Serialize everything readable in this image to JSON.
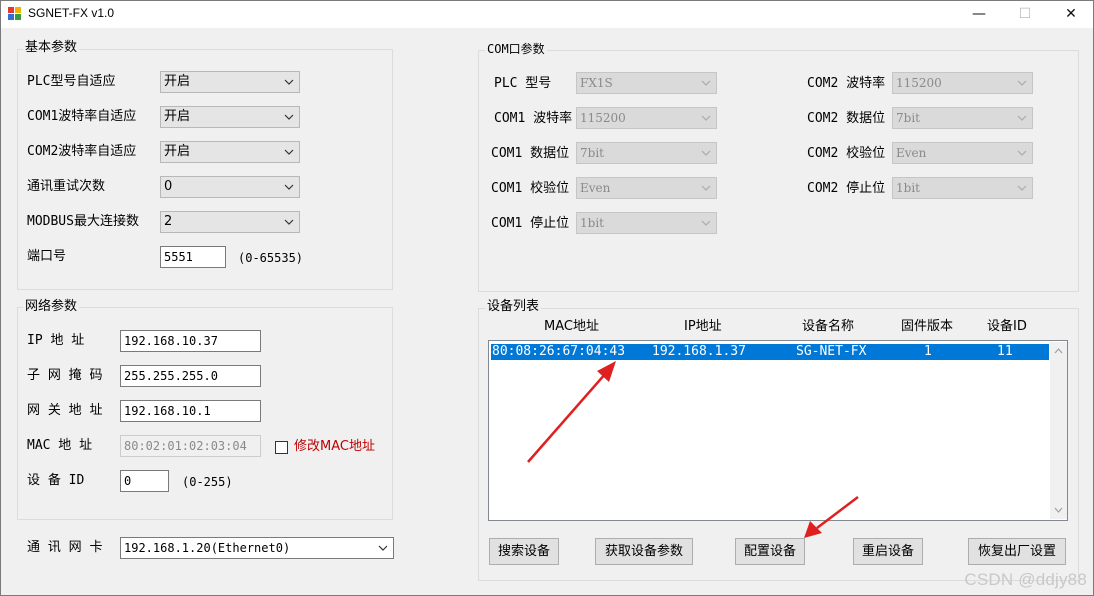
{
  "window": {
    "title": "SGNET-FX v1.0",
    "minimize": "—",
    "maximize": "☐",
    "close": "✕"
  },
  "basic": {
    "title": "基本参数",
    "rows": [
      {
        "label": "PLC型号自适应",
        "value": "开启"
      },
      {
        "label": "COM1波特率自适应",
        "value": "开启"
      },
      {
        "label": "COM2波特率自适应",
        "value": "开启"
      },
      {
        "label": "通讯重试次数",
        "value": "0"
      },
      {
        "label": "MODBUS最大连接数",
        "value": "2"
      }
    ],
    "port_label": "端口号",
    "port_value": "5551",
    "port_range": "(0-65535)"
  },
  "com": {
    "title": "COM口参数",
    "left": [
      {
        "label": "PLC 型号",
        "value": "FX1S"
      },
      {
        "label": "COM1 波特率",
        "value": "115200"
      },
      {
        "label": "COM1 数据位",
        "value": "7bit"
      },
      {
        "label": "COM1 校验位",
        "value": "Even"
      },
      {
        "label": "COM1 停止位",
        "value": "1bit"
      }
    ],
    "right": [
      {
        "label": "COM2 波特率",
        "value": "115200"
      },
      {
        "label": "COM2 数据位",
        "value": "7bit"
      },
      {
        "label": "COM2 校验位",
        "value": "Even"
      },
      {
        "label": "COM2 停止位",
        "value": "1bit"
      }
    ]
  },
  "network": {
    "title": "网络参数",
    "ip_label": "IP 地 址",
    "ip_value": "192.168.10.37",
    "mask_label": "子 网 掩 码",
    "mask_value": "255.255.255.0",
    "gateway_label": "网 关 地 址",
    "gateway_value": "192.168.10.1",
    "mac_label": "MAC 地 址",
    "mac_value": "80:02:01:02:03:04",
    "modify_mac_label": "修改MAC地址",
    "modify_mac_checked": false,
    "device_id_label": "设 备 ID",
    "device_id_value": "0",
    "device_id_range": "(0-255)"
  },
  "nic": {
    "label": "通 讯 网 卡",
    "value": "192.168.1.20(Ethernet0)"
  },
  "devices": {
    "title": "设备列表",
    "columns": [
      "MAC地址",
      "IP地址",
      "设备名称",
      "固件版本",
      "设备ID"
    ],
    "rows": [
      {
        "mac": "80:08:26:67:04:43",
        "ip": "192.168.1.37",
        "name": "SG-NET-FX",
        "firmware": "1",
        "id": "11"
      }
    ],
    "buttons": {
      "search": "搜索设备",
      "get_params": "获取设备参数",
      "configure": "配置设备",
      "restart": "重启设备",
      "factory_reset": "恢复出厂设置"
    }
  },
  "annotation_color": "#e02020",
  "selection_color": "#0078d7",
  "watermark": "CSDN @ddjy88"
}
